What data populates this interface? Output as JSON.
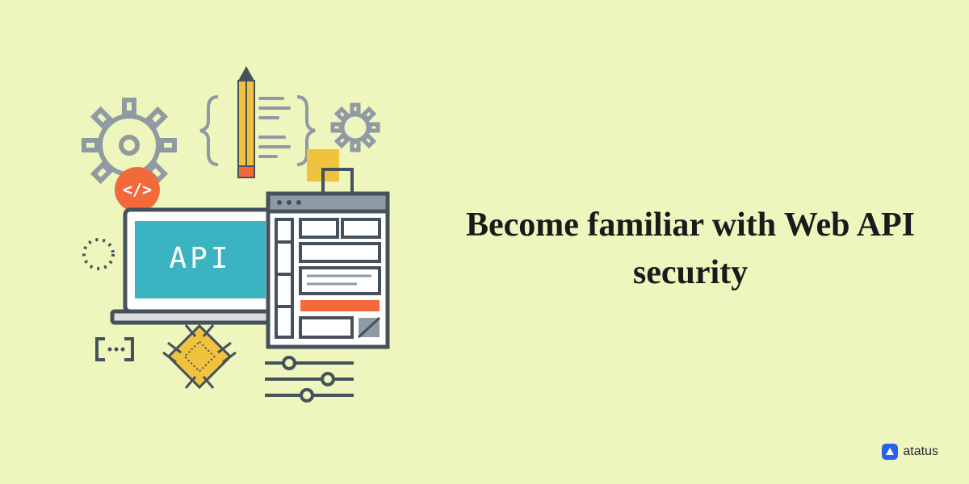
{
  "headline": "Become familiar with Web API security",
  "brand": {
    "name": "atatus"
  },
  "illustration": {
    "laptop_text": "API",
    "code_badge_glyph": "</>",
    "colors": {
      "teal": "#3bb4c1",
      "orange": "#f26a3c",
      "yellow": "#f0c23d",
      "grey": "#8f9aa3",
      "dark": "#3d4a54",
      "outline": "#45525c"
    }
  }
}
